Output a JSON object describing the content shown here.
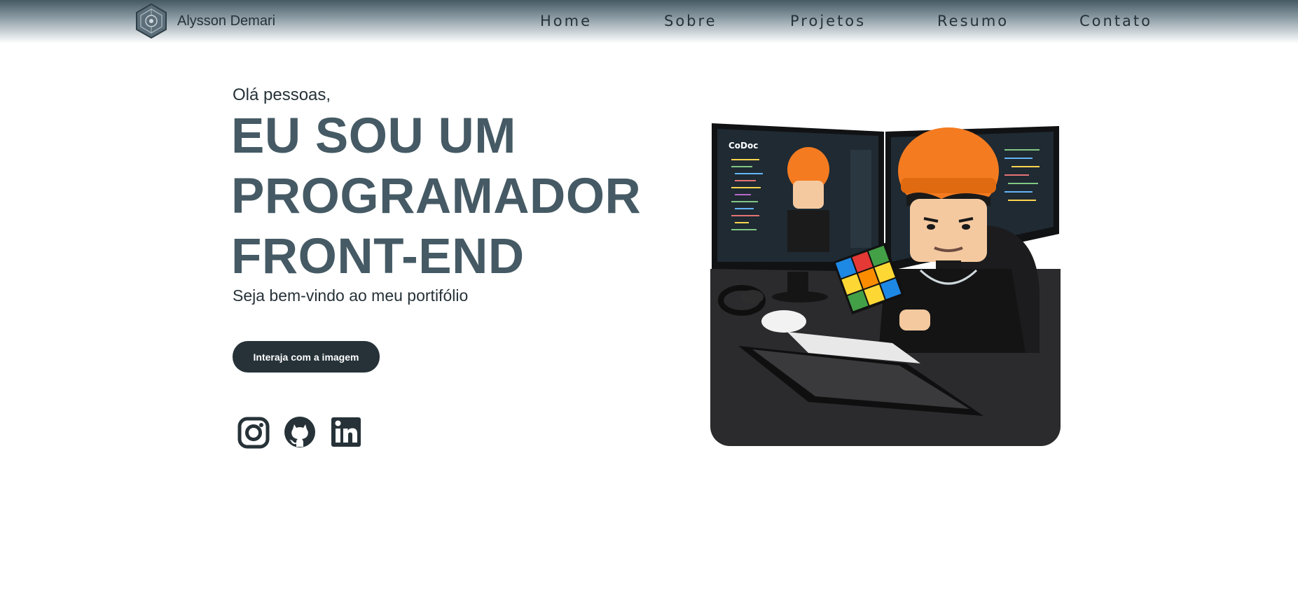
{
  "header": {
    "brand_name": "Alysson Demari",
    "logo_icon": "hexagon-emblem-logo",
    "nav": [
      {
        "label": "Home"
      },
      {
        "label": "Sobre"
      },
      {
        "label": "Projetos"
      },
      {
        "label": "Resumo"
      },
      {
        "label": "Contato"
      }
    ],
    "gradient_colors": [
      "#455a64",
      "#ffffff"
    ]
  },
  "hero": {
    "greeting": "Olá pessoas,",
    "headline_lines": [
      "EU SOU UM",
      "PROGRAMADOR",
      "FRONT-END"
    ],
    "subtitle": "Seja bem-vindo ao meu portifólio",
    "cta_label": "Interaja com a imagem",
    "socials": [
      {
        "icon": "instagram-icon"
      },
      {
        "icon": "github-icon"
      },
      {
        "icon": "linkedin-icon"
      }
    ],
    "image": {
      "description_icon": "lego-programmer-illustration",
      "screen_text": "CoDoc"
    }
  },
  "colors": {
    "dark": "#263238",
    "headline": "#455a64",
    "background": "#ffffff"
  }
}
